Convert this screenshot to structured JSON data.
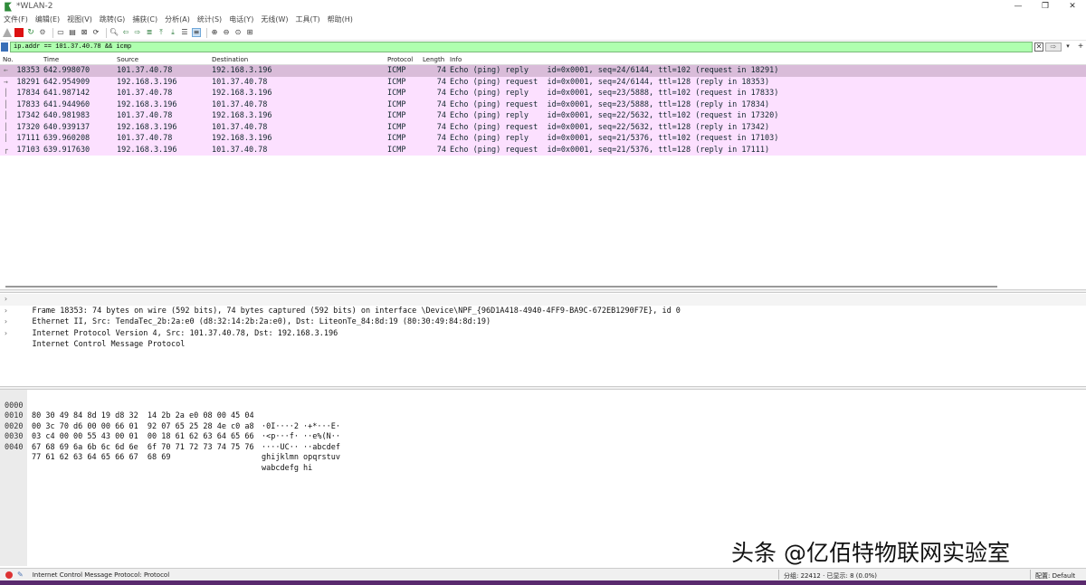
{
  "window": {
    "title": "*WLAN-2",
    "controls": {
      "minimize": "—",
      "maximize": "❐",
      "close": "✕"
    }
  },
  "menu": [
    "文件(F)",
    "编辑(E)",
    "视图(V)",
    "跳转(G)",
    "捕获(C)",
    "分析(A)",
    "统计(S)",
    "电话(Y)",
    "无线(W)",
    "工具(T)",
    "帮助(H)"
  ],
  "toolbar": {
    "icons": [
      "shark-fin-icon",
      "stop-capture-icon",
      "restart-capture-icon",
      "capture-options-icon",
      "open-file-icon",
      "save-file-icon",
      "close-file-icon",
      "reload-icon",
      "find-packet-icon",
      "go-back-icon",
      "go-forward-icon",
      "go-to-packet-icon",
      "first-packet-icon",
      "last-packet-icon",
      "auto-scroll-icon",
      "colorize-icon",
      "zoom-in-icon",
      "zoom-out-icon",
      "normal-size-icon",
      "resize-columns-icon"
    ]
  },
  "filter": {
    "value": "ip.addr == 101.37.40.78 && icmp",
    "clear": "✕",
    "apply": "⇨",
    "dropdown": "▾",
    "add": "+"
  },
  "packet_list": {
    "columns": [
      "No.",
      "Time",
      "Source",
      "Destination",
      "Protocol",
      "Length",
      "Info"
    ],
    "rows": [
      {
        "no": "18353",
        "time": "642.998070",
        "src": "101.37.40.78",
        "dst": "192.168.3.196",
        "proto": "ICMP",
        "len": "74",
        "info": "Echo (ping) reply    id=0x0001, seq=24/6144, ttl=102 (request in 18291)",
        "mark": "←",
        "selected": true
      },
      {
        "no": "18291",
        "time": "642.954909",
        "src": "192.168.3.196",
        "dst": "101.37.40.78",
        "proto": "ICMP",
        "len": "74",
        "info": "Echo (ping) request  id=0x0001, seq=24/6144, ttl=128 (reply in 18353)",
        "mark": "→"
      },
      {
        "no": "17834",
        "time": "641.987142",
        "src": "101.37.40.78",
        "dst": "192.168.3.196",
        "proto": "ICMP",
        "len": "74",
        "info": "Echo (ping) reply    id=0x0001, seq=23/5888, ttl=102 (request in 17833)",
        "mark": "│"
      },
      {
        "no": "17833",
        "time": "641.944960",
        "src": "192.168.3.196",
        "dst": "101.37.40.78",
        "proto": "ICMP",
        "len": "74",
        "info": "Echo (ping) request  id=0x0001, seq=23/5888, ttl=128 (reply in 17834)",
        "mark": "│"
      },
      {
        "no": "17342",
        "time": "640.981983",
        "src": "101.37.40.78",
        "dst": "192.168.3.196",
        "proto": "ICMP",
        "len": "74",
        "info": "Echo (ping) reply    id=0x0001, seq=22/5632, ttl=102 (request in 17320)",
        "mark": "│"
      },
      {
        "no": "17320",
        "time": "640.939137",
        "src": "192.168.3.196",
        "dst": "101.37.40.78",
        "proto": "ICMP",
        "len": "74",
        "info": "Echo (ping) request  id=0x0001, seq=22/5632, ttl=128 (reply in 17342)",
        "mark": "│"
      },
      {
        "no": "17111",
        "time": "639.960208",
        "src": "101.37.40.78",
        "dst": "192.168.3.196",
        "proto": "ICMP",
        "len": "74",
        "info": "Echo (ping) reply    id=0x0001, seq=21/5376, ttl=102 (request in 17103)",
        "mark": "│"
      },
      {
        "no": "17103",
        "time": "639.917630",
        "src": "192.168.3.196",
        "dst": "101.37.40.78",
        "proto": "ICMP",
        "len": "74",
        "info": "Echo (ping) request  id=0x0001, seq=21/5376, ttl=128 (reply in 17111)",
        "mark": "┌"
      }
    ],
    "row_color": "#fce0ff",
    "selected_color": "#d9bcd9"
  },
  "details": [
    "Frame 18353: 74 bytes on wire (592 bits), 74 bytes captured (592 bits) on interface \\Device\\NPF_{96D1A418-4940-4FF9-BA9C-672EB1290F7E}, id 0",
    "Ethernet II, Src: TendaTec_2b:2a:e0 (d8:32:14:2b:2a:e0), Dst: LiteonTe_84:8d:19 (80:30:49:84:8d:19)",
    "Internet Protocol Version 4, Src: 101.37.40.78, Dst: 192.168.3.196",
    "Internet Control Message Protocol"
  ],
  "bytes": [
    {
      "offset": "0000",
      "hex": "80 30 49 84 8d 19 d8 32  14 2b 2a e0 08 00 45 04",
      "ascii": "·0I····2 ·+*···E·"
    },
    {
      "offset": "0010",
      "hex": "00 3c 70 d6 00 00 66 01  92 07 65 25 28 4e c0 a8",
      "ascii": "·<p···f· ··e%(N··"
    },
    {
      "offset": "0020",
      "hex": "03 c4 00 00 55 43 00 01  00 18 61 62 63 64 65 66",
      "ascii": "····UC·· ··abcdef"
    },
    {
      "offset": "0030",
      "hex": "67 68 69 6a 6b 6c 6d 6e  6f 70 71 72 73 74 75 76",
      "ascii": "ghijklmn opqrstuv"
    },
    {
      "offset": "0040",
      "hex": "77 61 62 63 64 65 66 67  68 69",
      "ascii": "wabcdefg hi"
    }
  ],
  "watermark": "头条 @亿佰特物联网实验室",
  "statusbar": {
    "text": "Internet Control Message Protocol: Protocol",
    "packets": "分组: 22412 · 已显示: 8 (0.0%)",
    "profile": "配置: Default"
  }
}
